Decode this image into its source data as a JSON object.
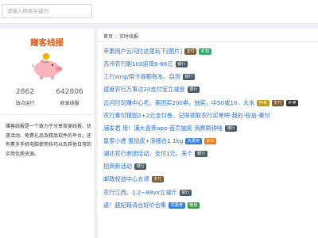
{
  "search": {
    "placeholder": "请输入搜索关键词"
  },
  "sidebar": {
    "title": "赚客线报",
    "stats": [
      {
        "value": "2862",
        "label": "站点运行"
      },
      {
        "value": "642806",
        "label": "收录线报"
      }
    ],
    "description": "赚客线报是一个致力于分享各类线报、优惠活动、免费礼品及精品软件的平台。还有素多手机电脑使用技巧以及其他日常的实用优质资源。"
  },
  "breadcrumb": [
    "首页",
    "实时线报"
  ],
  "colors": {
    "brand": "#e25a12",
    "link": "#2b6fd1",
    "tag_pay": "#7a5a2e",
    "tag_red": "#2dac68",
    "tag_bank": "#4a5966",
    "tag_coupon": "#2f7ee0",
    "tag_free": "#e87c1a",
    "tag_wechat": "#3a9b45",
    "tag_takeout": "#c29b12",
    "tag_dark": "#2a2e33"
  },
  "posts": [
    {
      "title": "苹果用户云闪付这里玩下[图片]",
      "tags": [
        {
          "label": "支付",
          "color": "#7a5a2e"
        },
        {
          "label": "红包",
          "color": "#2dac68"
        }
      ]
    },
    {
      "title": "苏州农行刷100返现6-66元",
      "tags": [
        {
          "label": "银行",
          "color": "#4a5966"
        }
      ]
    },
    {
      "title": "工行xing/用卡提额有水、自测",
      "tags": [
        {
          "label": "银行",
          "color": "#4a5966"
        }
      ]
    },
    {
      "title": "速度农行万事达20支付宝立减金",
      "tags": [
        {
          "label": "银行",
          "color": "#4a5966"
        }
      ]
    },
    {
      "title": "云闪付玩赚中心毛，美团买200券，抽奖，中50或10，大水",
      "tags": [
        {
          "label": "外卖",
          "color": "#c29b12"
        },
        {
          "label": "支付",
          "color": "#7a5a2e"
        },
        {
          "label": "外卖",
          "color": "#2a2e33"
        }
      ]
    },
    {
      "title": "农行秦付猎固2+2元支付卷，记得领取农行买单吧-我的-权益-秦付",
      "tags": []
    },
    {
      "title": "浦发君  用！浦大喜奔app-首页抽奖  消费刷钟啥",
      "tags": [
        {
          "label": "银行",
          "color": "#4a5966"
        }
      ]
    },
    {
      "title": "皇家小虎 蛋挞皮+液细合1.1kg",
      "tags": [
        {
          "label": "优惠券",
          "color": "#2f7ee0"
        },
        {
          "label": "京东",
          "color": "#e87c1a"
        }
      ]
    },
    {
      "title": "湖北农行参团活动，支付1元，来个",
      "tags": [
        {
          "label": "银行",
          "color": "#4a5966"
        }
      ]
    },
    {
      "title": "招商新活动",
      "tags": [
        {
          "label": "银行",
          "color": "#4a5966"
        }
      ]
    },
    {
      "title": "邮政权益中心去领",
      "tags": [
        {
          "label": "支付",
          "color": "#7a5a2e"
        }
      ]
    },
    {
      "title": "农行江西。1.2~88vx立减斤",
      "tags": [
        {
          "label": "银行",
          "color": "#4a5966"
        }
      ]
    },
    {
      "title": "速！骁妃藉清合好价合集",
      "tags": [
        {
          "label": "优惠券",
          "color": "#2f7ee0"
        },
        {
          "label": "微信",
          "color": "#3a9b45"
        }
      ]
    }
  ]
}
